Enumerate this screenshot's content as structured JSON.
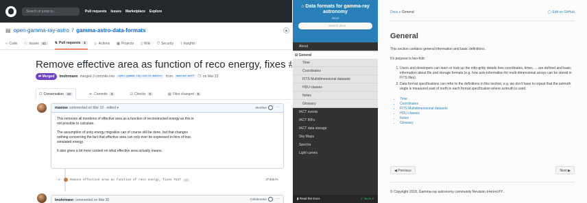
{
  "github": {
    "search_placeholder": "Search or jump to...",
    "nav": [
      "Pull requests",
      "Issues",
      "Marketplace",
      "Explore"
    ],
    "repo_owner": "open-gamma-ray-astro",
    "repo_name": "gamma-astro-data-formats",
    "tabs": [
      {
        "label": "Code",
        "count": ""
      },
      {
        "label": "Issues",
        "count": "41"
      },
      {
        "label": "Pull requests",
        "count": "1"
      },
      {
        "label": "Actions",
        "count": ""
      },
      {
        "label": "Projects",
        "count": ""
      },
      {
        "label": "Wiki",
        "count": ""
      },
      {
        "label": "Security",
        "count": ""
      },
      {
        "label": "Insights",
        "count": ""
      }
    ],
    "pr_title": "Remove effective area as function of reco energy, fixes #137",
    "pr_number": "#140",
    "pr_state": "Merged",
    "pr_author": "lmohrmann",
    "pr_meta_text": "merged 3 commits into",
    "pr_base": "open-gamma-ray-astro:master",
    "pr_from": "from",
    "pr_head": "maxnoe:aeff",
    "pr_date": "on Mar 23",
    "pr_tabs": [
      {
        "label": "Conversation",
        "count": "10"
      },
      {
        "label": "Commits",
        "count": "3"
      },
      {
        "label": "Checks",
        "count": "0"
      },
      {
        "label": "Files changed",
        "count": "5"
      }
    ],
    "comment1": {
      "author": "maxnoe",
      "meta": "commented on Mar 19 · edited",
      "role": "Member",
      "paragraphs": [
        "This removes all mentions of effective area as a function of reconstructed energy as this is not possible to calculate.",
        "The assumption of unity energy migration can of course still be done, but that changes nothing concerning the fact that effective area can only ever be expressed in bins of true, simulated energy.",
        "It also gives a bit more context on what effective area actually means."
      ]
    },
    "commit": {
      "message": "Remove effective area as function of reco energy, fixes #137",
      "sha": "3fd6b7e"
    },
    "comment2": {
      "author": "lmohrmann",
      "meta": "commented on Mar 20",
      "role": "Collaborator"
    }
  },
  "rtd": {
    "title": "Data formats for gamma-ray astronomy",
    "version": "latest",
    "search_placeholder": "Search docs",
    "menu": [
      {
        "label": "About",
        "kind": "top"
      },
      {
        "label": "General",
        "kind": "current"
      },
      {
        "label": "Time",
        "kind": "sub"
      },
      {
        "label": "Coordinates",
        "kind": "sub"
      },
      {
        "label": "FITS Multidimensional datasets",
        "kind": "sub"
      },
      {
        "label": "HDU classes",
        "kind": "sub"
      },
      {
        "label": "Notes",
        "kind": "sub"
      },
      {
        "label": "Glossary",
        "kind": "sub"
      },
      {
        "label": "IACT events",
        "kind": "top"
      },
      {
        "label": "IACT IRFs",
        "kind": "top"
      },
      {
        "label": "IACT data storage",
        "kind": "top"
      },
      {
        "label": "Sky Maps",
        "kind": "top"
      },
      {
        "label": "Spectra",
        "kind": "top"
      },
      {
        "label": "Light curves",
        "kind": "top"
      }
    ],
    "footer_label": "Read the Docs",
    "footer_version": "v: latest"
  },
  "doc": {
    "breadcrumb_docs": "Docs",
    "breadcrumb_sep": "»",
    "breadcrumb_current": "General",
    "edit_link": "Edit on GitHub",
    "heading": "General",
    "intro": "This section contains general information and basic definitions.",
    "purpose": "It's purpose is two-fold:",
    "points": [
      "Users and developers can learn or look up the nitty-gritty details how coordinates, times, ... are defined and basic information about file and storage formats (e.g. how axis-information for multi-dimensional arrays can be stored in FITS files).",
      "Data format specifications can refer to the definitions in this section, e.g. we don't have to repeat that the azimuth angle is measured east of north in each format specification where azimuth is used."
    ],
    "links": [
      "Time",
      "Coordinates",
      "FITS Multidimensional datasets",
      "HDU classes",
      "Notes",
      "Glossary"
    ],
    "prev_label": "Previous",
    "next_label": "Next",
    "copyright": "© Copyright 2018, Gamma-ray astronomy community Revision",
    "revision": "04e943ff."
  }
}
